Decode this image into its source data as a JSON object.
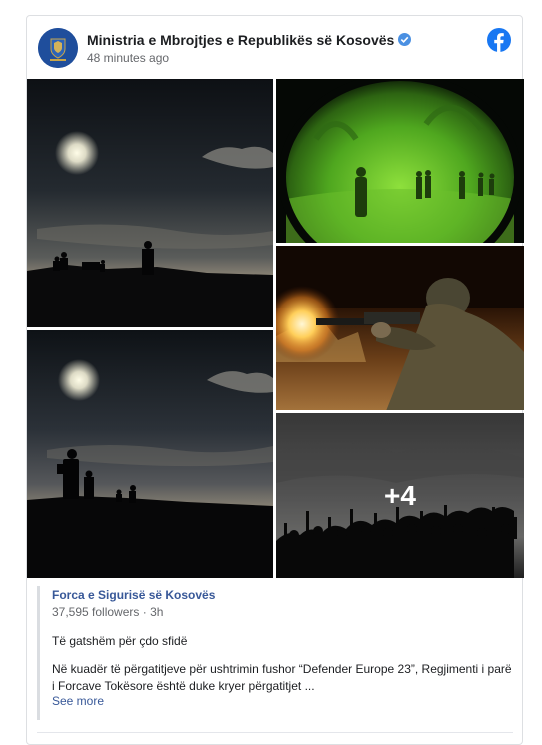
{
  "post": {
    "author": "Ministria e Mbrojtjes e Republikës së Kosovës",
    "time": "48 minutes ago",
    "colors": {
      "brand": "#1877f2",
      "link": "#385898",
      "muted": "#65676b",
      "verified": "#4a90e2"
    },
    "icons": {
      "brand": "facebook-icon",
      "verified": "verified-badge-icon"
    }
  },
  "photos": {
    "more_count": "+4",
    "items": [
      {
        "alt": "silhouettes-under-moon"
      },
      {
        "alt": "night-vision-patrol"
      },
      {
        "alt": "soldier-firing-rifle"
      },
      {
        "alt": "silhouettes-under-moon-2"
      },
      {
        "alt": "soldiers-rifles-raised"
      }
    ]
  },
  "shared_post": {
    "page_name": "Forca e Sigurisë së Kosovës",
    "followers": "37,595 followers",
    "separator": "·",
    "time": "3h",
    "line1": "Të gatshëm për çdo sfidë",
    "body": "Në kuadër të përgatitjeve për ushtrimin fushor “Defender Europe 23”, Regjimenti i parë i Forcave Tokësore është duke kryer përgatitjet ...",
    "see_more": "See more"
  }
}
